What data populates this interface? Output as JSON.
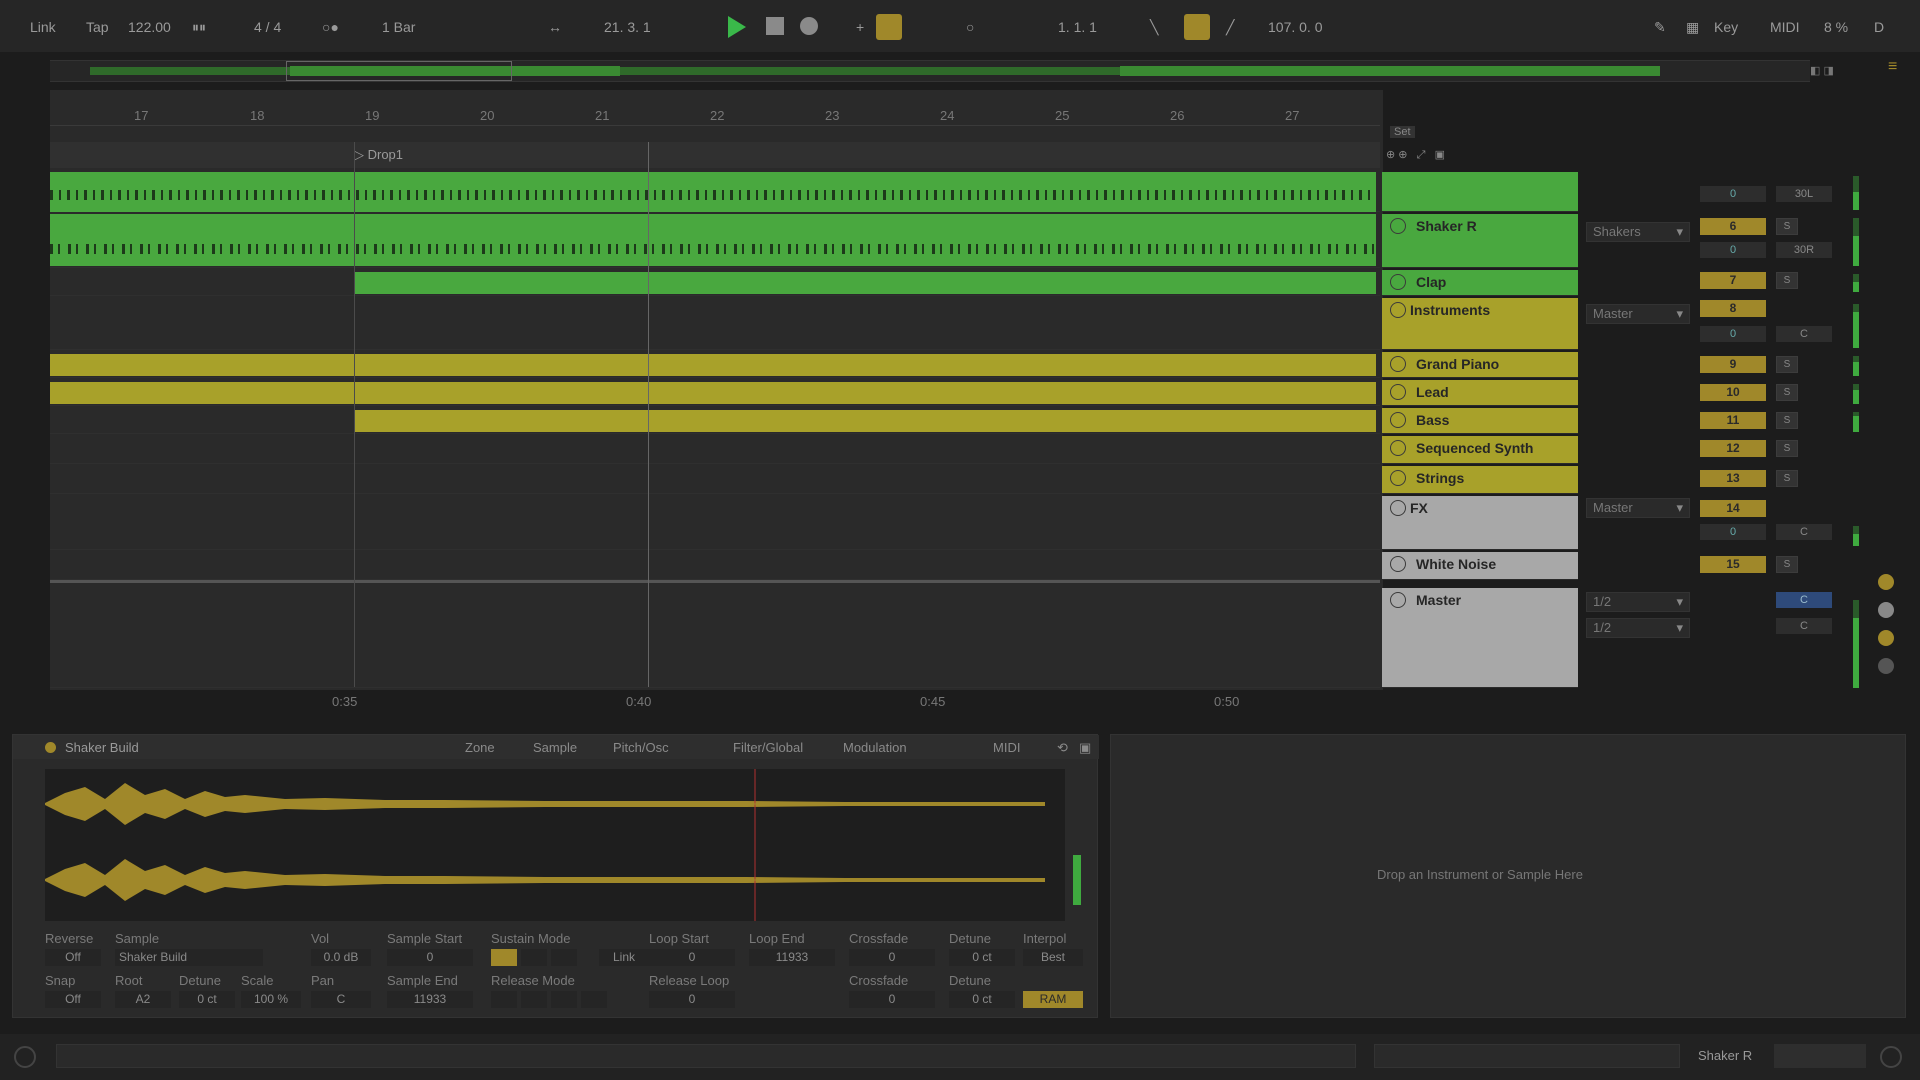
{
  "colors": {
    "green": "#49a83f",
    "yellow": "#a8a12a",
    "grey": "#a8a8a8",
    "accent": "#a0882a"
  },
  "transport": {
    "link": "Link",
    "tap": "Tap",
    "tempo": "122.00",
    "signature": "4 / 4",
    "quantize": "1 Bar",
    "position": "21.  3.  1",
    "loop_start": "1.  1.  1",
    "loop_length": "107.  0.  0",
    "key": "Key",
    "midi": "MIDI",
    "cpu": "8 %",
    "d": "D"
  },
  "ruler": {
    "bars": [
      "17",
      "18",
      "19",
      "20",
      "21",
      "22",
      "23",
      "24",
      "25",
      "26",
      "27"
    ]
  },
  "locator": "Drop1",
  "set_label": "Set",
  "time_labels": [
    "0:35",
    "0:40",
    "0:45",
    "0:50"
  ],
  "tracks": [
    {
      "name": "",
      "color": "green",
      "kind": "track"
    },
    {
      "name": "Shaker R",
      "color": "green",
      "kind": "track"
    },
    {
      "name": "Clap",
      "color": "green",
      "kind": "track"
    },
    {
      "name": "Instruments",
      "color": "yellow",
      "kind": "group"
    },
    {
      "name": "Grand Piano",
      "color": "yellow",
      "kind": "track"
    },
    {
      "name": "Lead",
      "color": "yellow",
      "kind": "track"
    },
    {
      "name": "Bass",
      "color": "yellow",
      "kind": "track"
    },
    {
      "name": "Sequenced Synth",
      "color": "yellow",
      "kind": "track"
    },
    {
      "name": "Strings",
      "color": "yellow",
      "kind": "track"
    },
    {
      "name": "FX",
      "color": "grey",
      "kind": "group"
    },
    {
      "name": "White Noise",
      "color": "grey",
      "kind": "track"
    },
    {
      "name": "Master",
      "color": "grey",
      "kind": "master"
    }
  ],
  "mixer": {
    "io": [
      "Shakers",
      "Shakers",
      "Master",
      "Master",
      "1/2",
      "1/2"
    ],
    "numbers": [
      "",
      "6",
      "7",
      "8",
      "9",
      "10",
      "11",
      "12",
      "13",
      "14",
      "15"
    ],
    "vol_labels": [
      "0",
      "0",
      "0",
      "0"
    ],
    "pan_labels": [
      "30L",
      "30R",
      "C",
      "C",
      "C",
      "C"
    ],
    "solo": "S"
  },
  "device": {
    "title": "Shaker Build",
    "tabs": [
      "Zone",
      "Sample",
      "Pitch/Osc",
      "Filter/Global",
      "Modulation",
      "MIDI"
    ],
    "params": {
      "reverse_l": "Reverse",
      "reverse_v": "Off",
      "sample_l": "Sample",
      "sample_v": "Shaker Build",
      "vol_l": "Vol",
      "vol_v": "0.0 dB",
      "sstart_l": "Sample Start",
      "sstart_v": "0",
      "sustain_l": "Sustain Mode",
      "link": "Link",
      "lstart_l": "Loop Start",
      "lstart_v": "0",
      "lend_l": "Loop End",
      "lend_v": "11933",
      "cross_l": "Crossfade",
      "cross_v": "0",
      "detune_l": "Detune",
      "detune_v": "0 ct",
      "interp_l": "Interpol",
      "interp_v": "Best",
      "snap_l": "Snap",
      "snap_v": "Off",
      "root_l": "Root",
      "root_v": "A2",
      "detune2_l": "Detune",
      "detune2_v": "0 ct",
      "scale_l": "Scale",
      "scale_v": "100 %",
      "pan_l": "Pan",
      "pan_v": "C",
      "send_l": "Sample End",
      "send_v": "11933",
      "release_l": "Release Mode",
      "rloop_l": "Release Loop",
      "rloop_v": "0",
      "cross2_l": "Crossfade",
      "cross2_v": "0",
      "detune3_l": "Detune",
      "detune3_v": "0 ct",
      "ram": "RAM"
    }
  },
  "drop_text": "Drop an Instrument or Sample Here",
  "status": {
    "track": "Shaker R"
  }
}
